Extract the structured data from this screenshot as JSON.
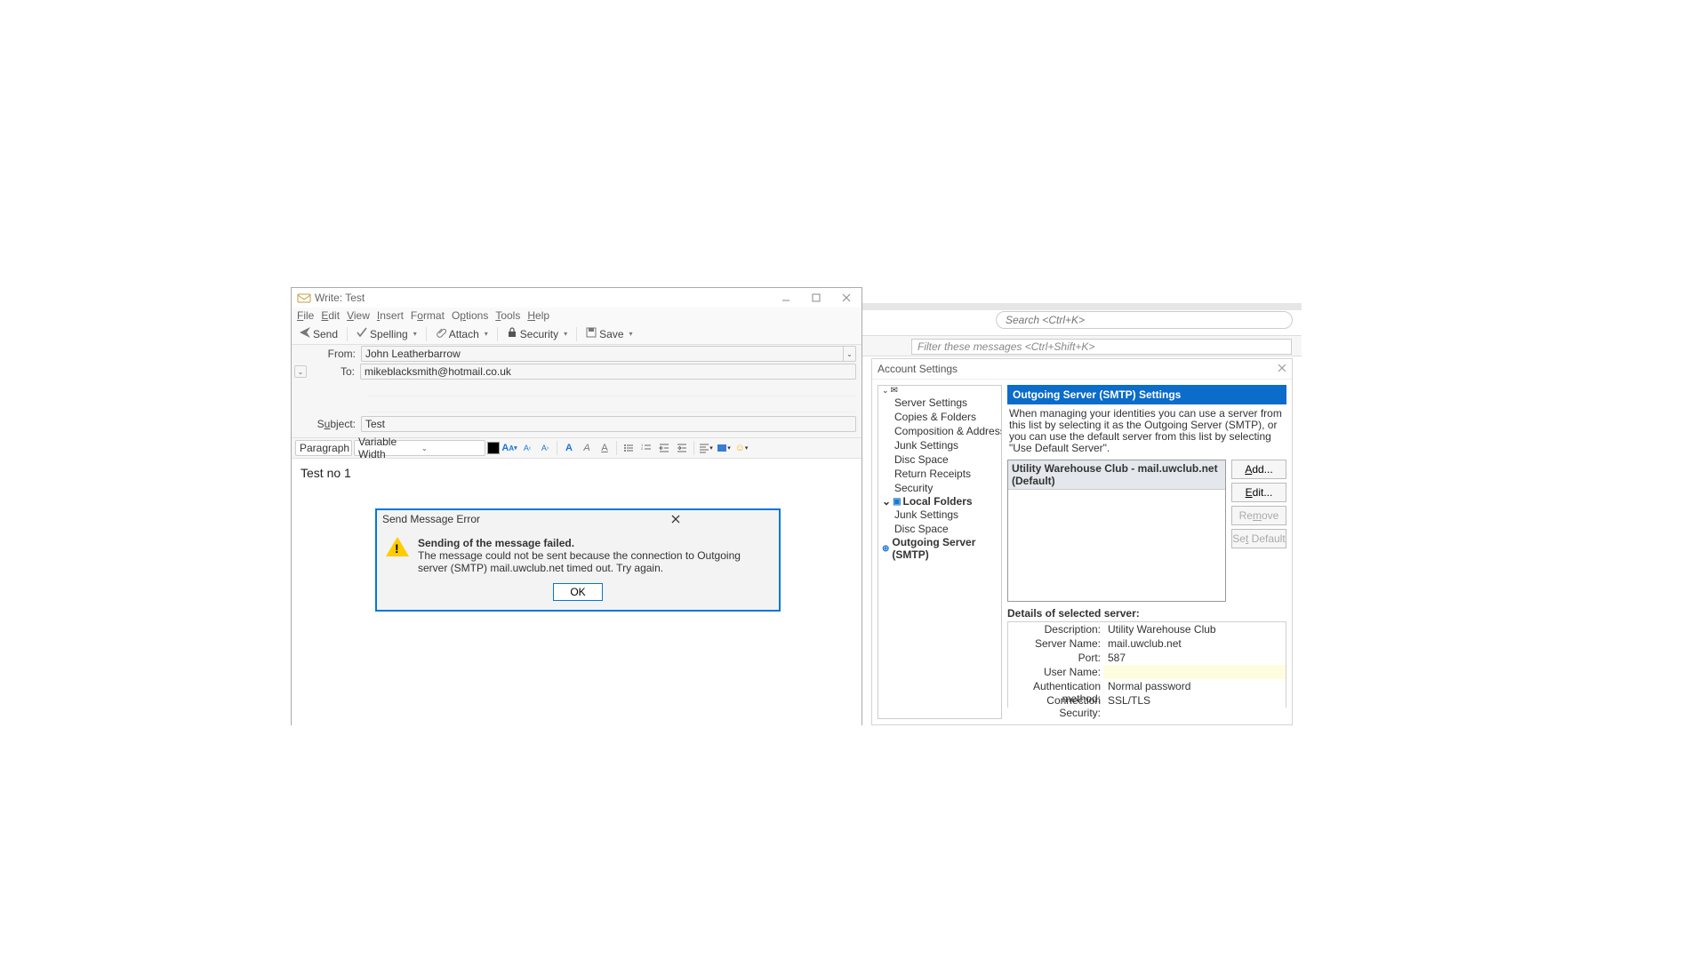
{
  "compose_window": {
    "title": "Write: Test",
    "menus": [
      "File",
      "Edit",
      "View",
      "Insert",
      "Format",
      "Options",
      "Tools",
      "Help"
    ],
    "toolbar": {
      "send": "Send",
      "spelling": "Spelling",
      "attach": "Attach",
      "security": "Security",
      "save": "Save"
    },
    "headers": {
      "from_label": "From:",
      "from_value": "John Leatherbarrow",
      "to_label": "To:",
      "to_value": "mikeblacksmith@hotmail.co.uk",
      "subject_label": "Subject:",
      "subject_value": "Test"
    },
    "format_bar": {
      "paragraph": "Paragraph",
      "font": "Variable Width"
    },
    "body": "Test no 1"
  },
  "error_dialog": {
    "title": "Send Message Error",
    "line1": "Sending of the message failed.",
    "line2": "The message could not be sent because the connection to Outgoing server (SMTP) mail.uwclub.net timed out. Try again.",
    "ok": "OK"
  },
  "background": {
    "search_placeholder": "Search <Ctrl+K>",
    "filter_placeholder": "Filter these messages <Ctrl+Shift+K>"
  },
  "account_settings": {
    "title": "Account Settings",
    "tree": {
      "server_settings": "Server Settings",
      "copies": "Copies & Folders",
      "composition": "Composition & Addressing",
      "junk": "Junk Settings",
      "disc": "Disc Space",
      "receipts": "Return Receipts",
      "security": "Security",
      "local": "Local Folders",
      "junk2": "Junk Settings",
      "disc2": "Disc Space",
      "smtp": "Outgoing Server (SMTP)"
    },
    "panel": {
      "header": "Outgoing Server (SMTP) Settings",
      "desc": "When managing your identities you can use a server from this list by selecting it as the Outgoing Server (SMTP), or you can use the default server from this list by selecting \"Use Default Server\".",
      "list_item": "Utility Warehouse Club - mail.uwclub.net (Default)",
      "buttons": {
        "add": "Add...",
        "edit": "Edit...",
        "remove": "Remove",
        "default": "Set Default"
      },
      "details_title": "Details of selected server:",
      "details": {
        "desc_l": "Description:",
        "desc_v": "Utility Warehouse Club",
        "server_l": "Server Name:",
        "server_v": "mail.uwclub.net",
        "port_l": "Port:",
        "port_v": "587",
        "user_l": "User Name:",
        "user_v": "",
        "auth_l": "Authentication method:",
        "auth_v": "Normal password",
        "conn_l": "Connection Security:",
        "conn_v": "SSL/TLS"
      }
    }
  }
}
